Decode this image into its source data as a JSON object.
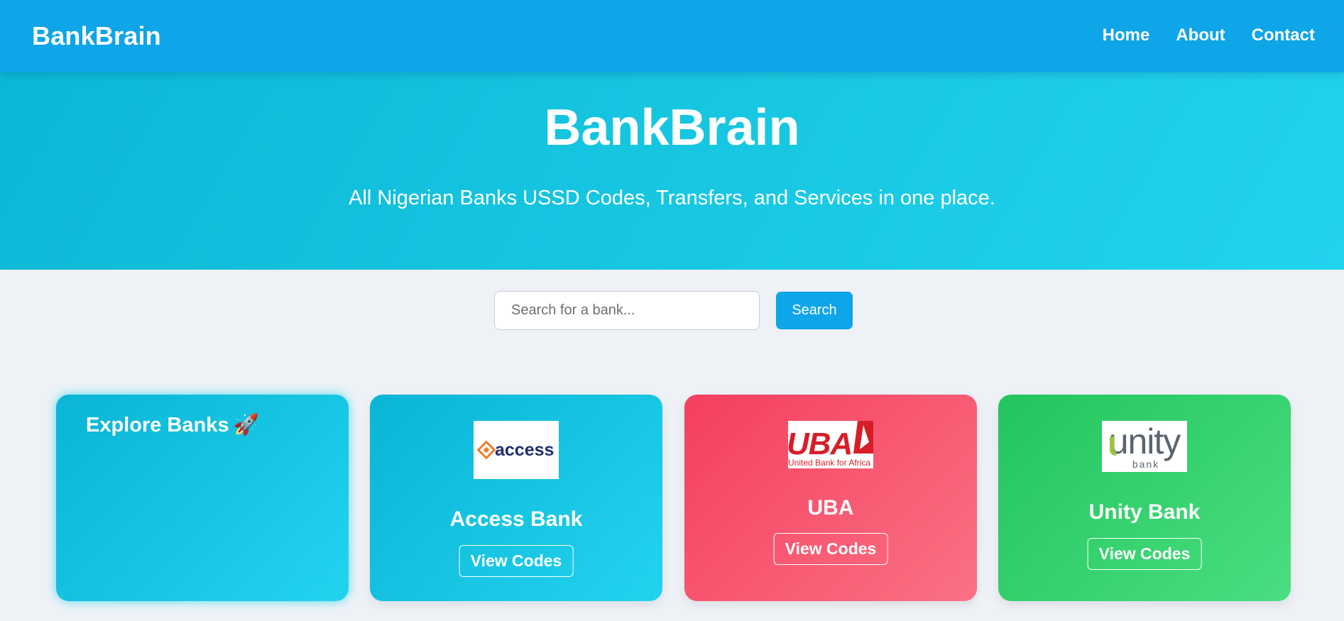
{
  "navbar": {
    "brand": "BankBrain",
    "links": [
      "Home",
      "About",
      "Contact"
    ]
  },
  "hero": {
    "title": "BankBrain",
    "subtitle": "All Nigerian Banks USSD Codes, Transfers, and Services in one place."
  },
  "search": {
    "placeholder": "Search for a bank...",
    "value": "",
    "button_label": "Search"
  },
  "explore_card": {
    "title": "Explore Banks",
    "emoji": "🚀"
  },
  "banks": [
    {
      "name": "Access Bank",
      "button_label": "View Codes",
      "logo_text": "access",
      "logo_icon": "access-diamond-icon"
    },
    {
      "name": "UBA",
      "button_label": "View Codes",
      "logo_text": "UBA",
      "logo_subtext": "United Bank for Africa",
      "logo_icon": "uba-logo"
    },
    {
      "name": "Unity Bank",
      "button_label": "View Codes",
      "logo_text": "unity",
      "logo_subtext": "bank",
      "logo_icon": "unity-logo"
    }
  ],
  "colors": {
    "navbar": "#0ea5e9",
    "hero_start": "#0bb7d6",
    "hero_end": "#22d3ee",
    "access_card": "#22d3ee",
    "uba_card": "#f43f5e",
    "unity_card": "#22c55e",
    "access_orange": "#f47b20",
    "access_navy": "#1e2e6e",
    "uba_red": "#d71e28",
    "unity_gray": "#5a6470",
    "unity_green": "#9bc53d"
  }
}
